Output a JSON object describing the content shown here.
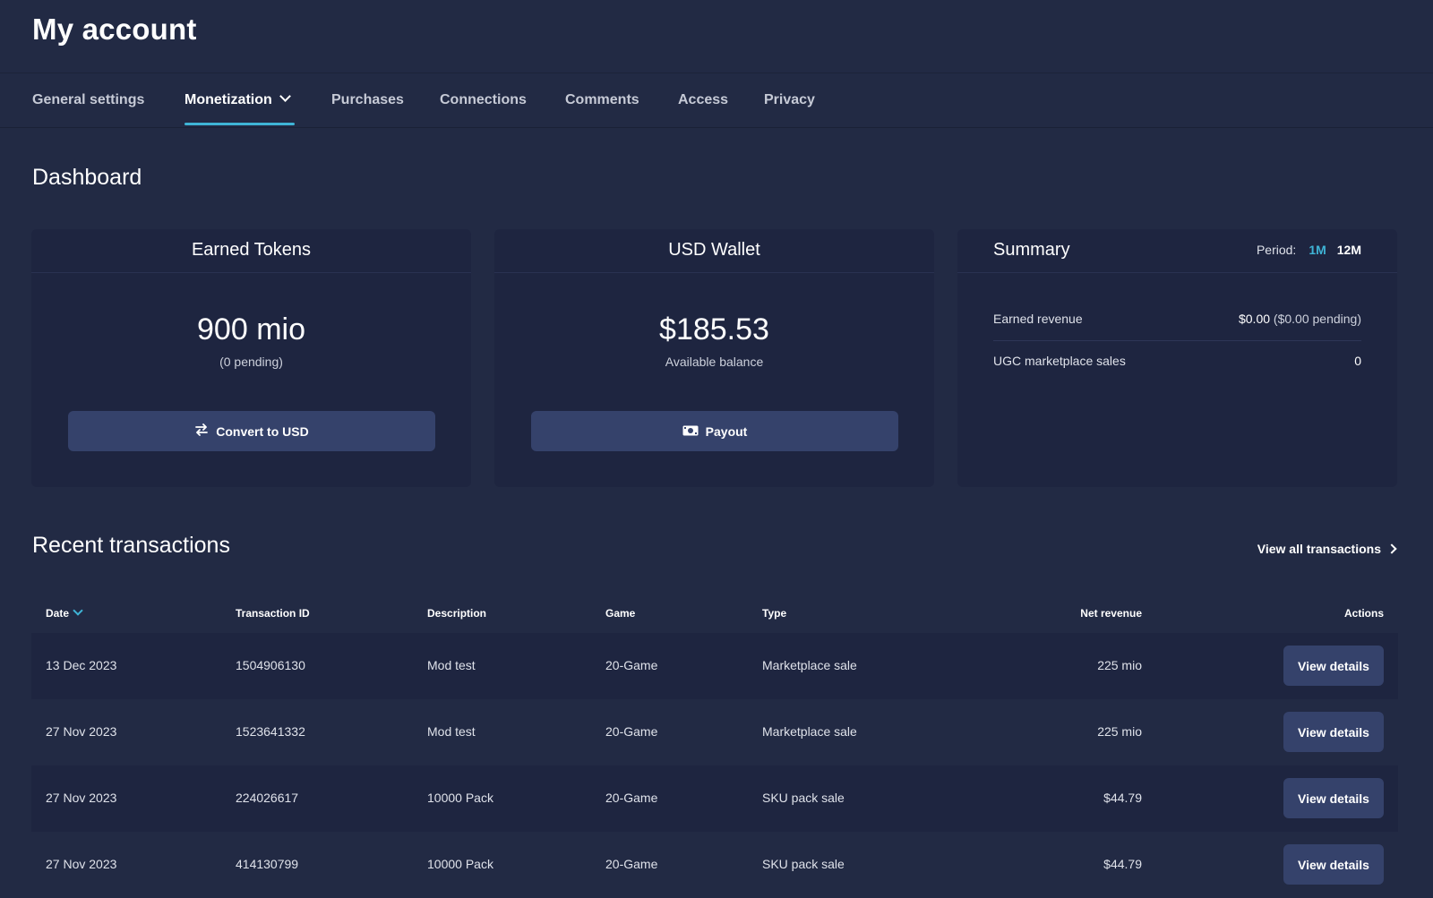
{
  "page": {
    "title": "My account"
  },
  "tabs": [
    {
      "label": "General settings"
    },
    {
      "label": "Monetization"
    },
    {
      "label": "Purchases"
    },
    {
      "label": "Connections"
    },
    {
      "label": "Comments"
    },
    {
      "label": "Access"
    },
    {
      "label": "Privacy"
    }
  ],
  "active_tab": "Monetization",
  "dashboard": {
    "title": "Dashboard",
    "earned_tokens": {
      "title": "Earned Tokens",
      "value": "900 mio",
      "sub": "(0 pending)",
      "button_label": "Convert to USD",
      "button_icon": "swap-arrows-icon"
    },
    "usd_wallet": {
      "title": "USD Wallet",
      "value": "$185.53",
      "sub": "Available balance",
      "button_label": "Payout",
      "button_icon": "cash-icon"
    },
    "summary": {
      "title": "Summary",
      "period_label": "Period:",
      "period_options": [
        "1M",
        "12M"
      ],
      "period_selected": "1M",
      "rows": [
        {
          "label": "Earned revenue",
          "value": "$0.00",
          "pending": "($0.00 pending)"
        },
        {
          "label": "UGC marketplace sales",
          "value": "0"
        }
      ]
    }
  },
  "transactions": {
    "title": "Recent transactions",
    "view_all_label": "View all transactions",
    "columns": [
      "Date",
      "Transaction ID",
      "Description",
      "Game",
      "Type",
      "Net revenue",
      "Actions"
    ],
    "sort_column": "Date",
    "rows": [
      {
        "date": "13 Dec 2023",
        "id": "1504906130",
        "description": "Mod test",
        "game": "20-Game",
        "type": "Marketplace sale",
        "net": "225 mio",
        "action": "View details"
      },
      {
        "date": "27 Nov 2023",
        "id": "1523641332",
        "description": "Mod test",
        "game": "20-Game",
        "type": "Marketplace sale",
        "net": "225 mio",
        "action": "View details"
      },
      {
        "date": "27 Nov 2023",
        "id": "224026617",
        "description": "10000 Pack",
        "game": "20-Game",
        "type": "SKU pack sale",
        "net": "$44.79",
        "action": "View details"
      },
      {
        "date": "27 Nov 2023",
        "id": "414130799",
        "description": "10000 Pack",
        "game": "20-Game",
        "type": "SKU pack sale",
        "net": "$44.79",
        "action": "View details"
      }
    ]
  },
  "colors": {
    "background": "#222a44",
    "card": "#1e2540",
    "button": "#35426b",
    "accent": "#3fb4d6"
  }
}
